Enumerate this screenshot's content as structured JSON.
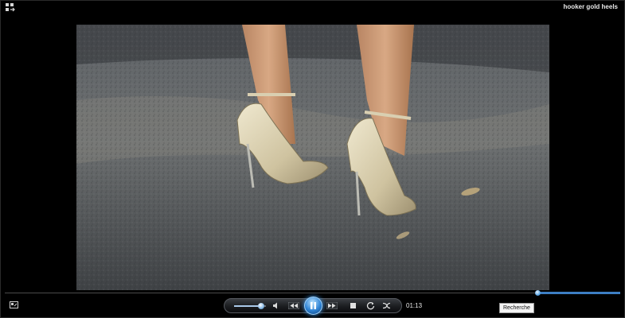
{
  "window": {
    "title": "hooker gold heels"
  },
  "video": {
    "description_icon": "video-frame"
  },
  "playback": {
    "time": "01:13",
    "seek_fraction": 0.135,
    "volume_fraction": 0.85,
    "state": "playing"
  },
  "toolbar": {
    "search_label": "Recherche"
  },
  "icons": {
    "switch": "switch-view-icon",
    "library": "library-icon",
    "mute": "speaker-icon",
    "previous": "previous-icon",
    "pause": "pause-icon",
    "next": "next-icon",
    "stop": "stop-icon",
    "repeat": "repeat-icon",
    "shuffle": "shuffle-icon"
  },
  "colors": {
    "accent": "#3d7fc4",
    "background": "#000000"
  }
}
